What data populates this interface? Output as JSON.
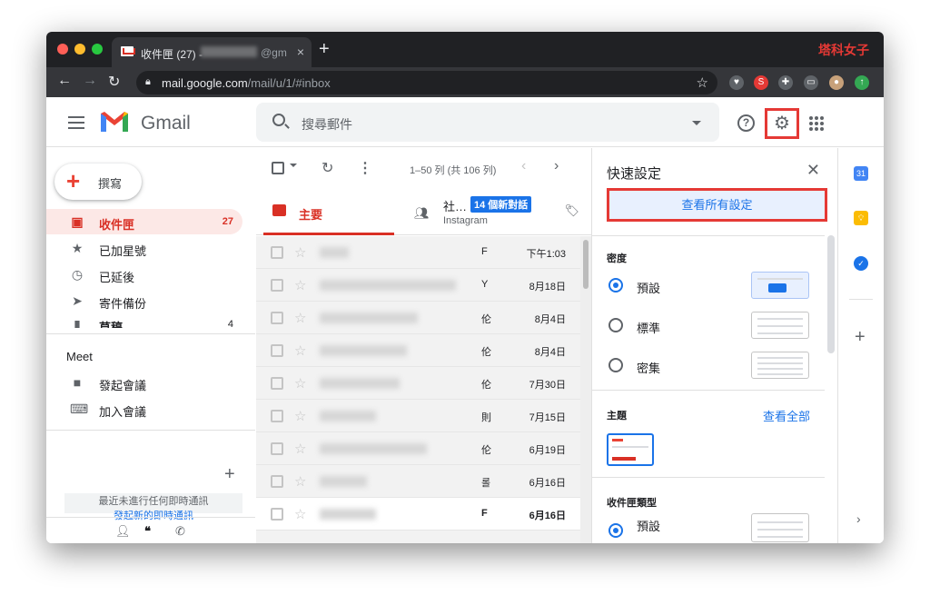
{
  "browser": {
    "tab_title": "收件匣 (27) -",
    "tab_title_suffix": "@gm",
    "tab_close": "×",
    "new_tab": "+",
    "brand": "塔科女子",
    "url_host": "mail.google.com",
    "url_path": "/mail/u/1/#inbox"
  },
  "header": {
    "app_name": "Gmail",
    "search_placeholder": "搜尋郵件"
  },
  "sidebar": {
    "compose_label": "撰寫",
    "items": [
      {
        "icon": "inbox-icon",
        "label": "收件匣",
        "count": "27",
        "active": true
      },
      {
        "icon": "star-icon",
        "label": "已加星號",
        "count": ""
      },
      {
        "icon": "clock-icon",
        "label": "已延後",
        "count": ""
      },
      {
        "icon": "send-icon",
        "label": "寄件備份",
        "count": ""
      },
      {
        "icon": "draft-icon",
        "label": "草稿",
        "count": "4"
      }
    ],
    "meet_heading": "Meet",
    "meet_items": [
      {
        "icon": "video-icon",
        "label": "發起會議"
      },
      {
        "icon": "keyboard-icon",
        "label": "加入會議"
      }
    ],
    "hangouts_text": "最近未進行任何即時通訊",
    "hangouts_link": "發起新的即時通訊"
  },
  "mail": {
    "pagination": "1–50 列 (共 106 列)",
    "tab_primary": "主要",
    "tab_social": "社…",
    "tab_social_badge": "14 個新對話",
    "tab_social_sub": "Instagram",
    "rows": [
      {
        "sender": "F",
        "date": "下午1:03",
        "unread": false
      },
      {
        "sender": "Y",
        "date": "8月18日",
        "unread": false
      },
      {
        "sender": "伦",
        "date": "8月4日",
        "unread": false
      },
      {
        "sender": "伦",
        "date": "8月4日",
        "unread": false
      },
      {
        "sender": "伦",
        "date": "7月30日",
        "unread": false
      },
      {
        "sender": "則",
        "date": "7月15日",
        "unread": false
      },
      {
        "sender": "伦",
        "date": "6月19日",
        "unread": false
      },
      {
        "sender": "롤",
        "date": "6月16日",
        "unread": false
      },
      {
        "sender": "F",
        "date": "6月16日",
        "unread": true
      }
    ]
  },
  "quick_settings": {
    "title": "快速設定",
    "view_all_button": "查看所有設定",
    "density_heading": "密度",
    "density_options": [
      "預設",
      "標準",
      "密集"
    ],
    "theme_heading": "主題",
    "theme_link": "查看全部",
    "inbox_type_heading": "收件匣類型",
    "inbox_type_option": "預設"
  },
  "colors": {
    "accent_red": "#d93025",
    "highlight_box": "#e53935",
    "link_blue": "#1a73e8"
  }
}
